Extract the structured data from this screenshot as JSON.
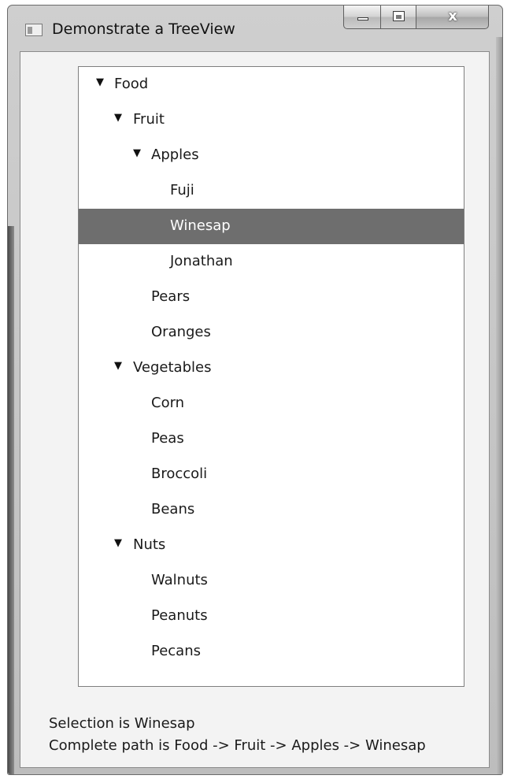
{
  "window": {
    "title": "Demonstrate a TreeView",
    "close_glyph": "x"
  },
  "tree": {
    "expand_arrow": "▼",
    "items": [
      {
        "label": "Food",
        "level": 0,
        "expanded": true,
        "selected": false
      },
      {
        "label": "Fruit",
        "level": 1,
        "expanded": true,
        "selected": false
      },
      {
        "label": "Apples",
        "level": 2,
        "expanded": true,
        "selected": false
      },
      {
        "label": "Fuji",
        "level": 3,
        "selected": false
      },
      {
        "label": "Winesap",
        "level": 3,
        "selected": true
      },
      {
        "label": "Jonathan",
        "level": 3,
        "selected": false
      },
      {
        "label": "Pears",
        "level": 2,
        "selected": false
      },
      {
        "label": "Oranges",
        "level": 2,
        "selected": false
      },
      {
        "label": "Vegetables",
        "level": 1,
        "expanded": true,
        "selected": false
      },
      {
        "label": "Corn",
        "level": 2,
        "selected": false
      },
      {
        "label": "Peas",
        "level": 2,
        "selected": false
      },
      {
        "label": "Broccoli",
        "level": 2,
        "selected": false
      },
      {
        "label": "Beans",
        "level": 2,
        "selected": false
      },
      {
        "label": "Nuts",
        "level": 1,
        "expanded": true,
        "selected": false
      },
      {
        "label": "Walnuts",
        "level": 2,
        "selected": false
      },
      {
        "label": "Peanuts",
        "level": 2,
        "selected": false
      },
      {
        "label": "Pecans",
        "level": 2,
        "selected": false
      }
    ]
  },
  "status": {
    "selection_text": "Selection is Winesap",
    "path_text": "Complete path is Food -> Fruit -> Apples -> Winesap"
  },
  "colors": {
    "selection_background": "#6e6e6e",
    "selection_text": "#ffffff"
  }
}
